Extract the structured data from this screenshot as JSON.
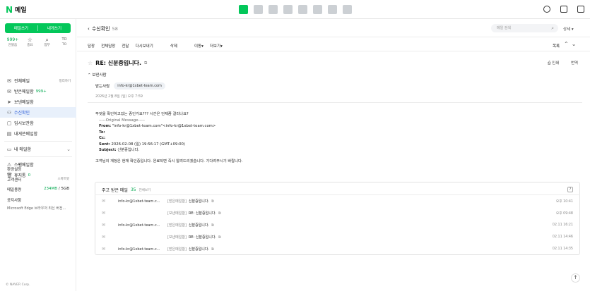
{
  "header": {
    "logo_letter": "N",
    "logo_text": "메일",
    "apps": [
      "mail-app-icon",
      "calendar-app-icon",
      "photo-app-icon",
      "contacts-app-icon",
      "settings-app-icon",
      "drive-app-icon",
      "memo-app-icon",
      "bookmark-app-icon"
    ],
    "brand_corner": "N",
    "accent": "#03c75a"
  },
  "sidebar": {
    "compose": "메일쓰기",
    "self_compose": "내게쓰기",
    "quick": [
      {
        "top": "999+",
        "label": "안읽음"
      },
      {
        "top": "☆",
        "label": "중요"
      },
      {
        "top": "⌕",
        "label": "첨부"
      },
      {
        "top": "TO",
        "label": "TO"
      }
    ],
    "items": [
      {
        "icon": "✉",
        "label": "전체메일",
        "side": "정리하기"
      },
      {
        "icon": "✉",
        "label": "받은메일함",
        "count": "999+"
      },
      {
        "icon": "➤",
        "label": "보낸메일함"
      },
      {
        "icon": "⚇",
        "label": "수신확인"
      },
      {
        "icon": "▢",
        "label": "임시보관함"
      },
      {
        "icon": "▤",
        "label": "내게쓴메일함"
      }
    ],
    "my_mail": "내 메일함",
    "spam": "스팸메일함",
    "trash": "휴지통",
    "trash_count": "0",
    "settings": "환경설정",
    "support": "고객센터",
    "support_side": "스마트봇",
    "storage_label": "메일용량",
    "storage_value": "234MB",
    "storage_total": "5GB",
    "notice_title": "공지사항",
    "notice_text": "Microsoft Edge 브라우저 최신 버전...",
    "copyright": "© NAVER Corp."
  },
  "toolbar": {
    "back_label": "수신확인",
    "back_count": "58",
    "search_placeholder": "메일 검색",
    "detail": "상세",
    "buttons": [
      "답장",
      "전체답장",
      "전달",
      "다시보내기",
      "삭제",
      "이동",
      "더보기"
    ],
    "list": "목록"
  },
  "mail": {
    "subject": "RE: 신분증입니다.",
    "print": "인쇄",
    "translate": "번역",
    "sender_toggle": "보낸사람",
    "recipient_label": "받는사람",
    "recipient": "info-kr@1xbet-team.com",
    "date": "2026년 2월 8일 (일) 오후 7:59",
    "body_question": "무엇을 확인하고있는 중인가요??? 시간은 언제쯤 걸리나요?",
    "orig_header": "-----Original Message-----",
    "from_label": "From:",
    "from_value": "\"info-kr@1xbet-team.com\"<info-kr@1xbet-team.com>",
    "to_label": "To:",
    "to_value": "",
    "cc_label": "Cc:",
    "cc_value": "",
    "sent_label": "Sent:",
    "sent_value": "2026-02-08 (일) 19:56:17 (GMT+09:00)",
    "subject_label": "Subject:",
    "subject_value": "신분증입니다.",
    "body_reply": "고객님의 계정은 현재 확인중입니다. 완료되면 즉시 알려드리겠습니다. 기다려주시기 바랍니다."
  },
  "thread": {
    "title": "주고 받은 메일",
    "count": "35",
    "view_all": "전체보기",
    "help": "?",
    "rows": [
      {
        "from": "info-kr@1xbet-team.c...",
        "prefix": "[받은메일함]",
        "title": "신분증입니다.",
        "time": "오후 10:41"
      },
      {
        "from": "",
        "prefix": "[보낸메일함]",
        "title": "RE: 신분증입니다.",
        "time": "오후 09:48"
      },
      {
        "from": "info-kr@1xbet-team.c...",
        "prefix": "[받은메일함]",
        "title": "신분증입니다.",
        "time": "02.11 16:21"
      },
      {
        "from": "",
        "prefix": "[보낸메일함]",
        "title": "RE: 신분증입니다.",
        "time": "02.11 14:46"
      },
      {
        "from": "info-kr@1xbet-team.c...",
        "prefix": "[받은메일함]",
        "title": "신분증입니다.",
        "time": "02.11 14:35"
      }
    ]
  }
}
